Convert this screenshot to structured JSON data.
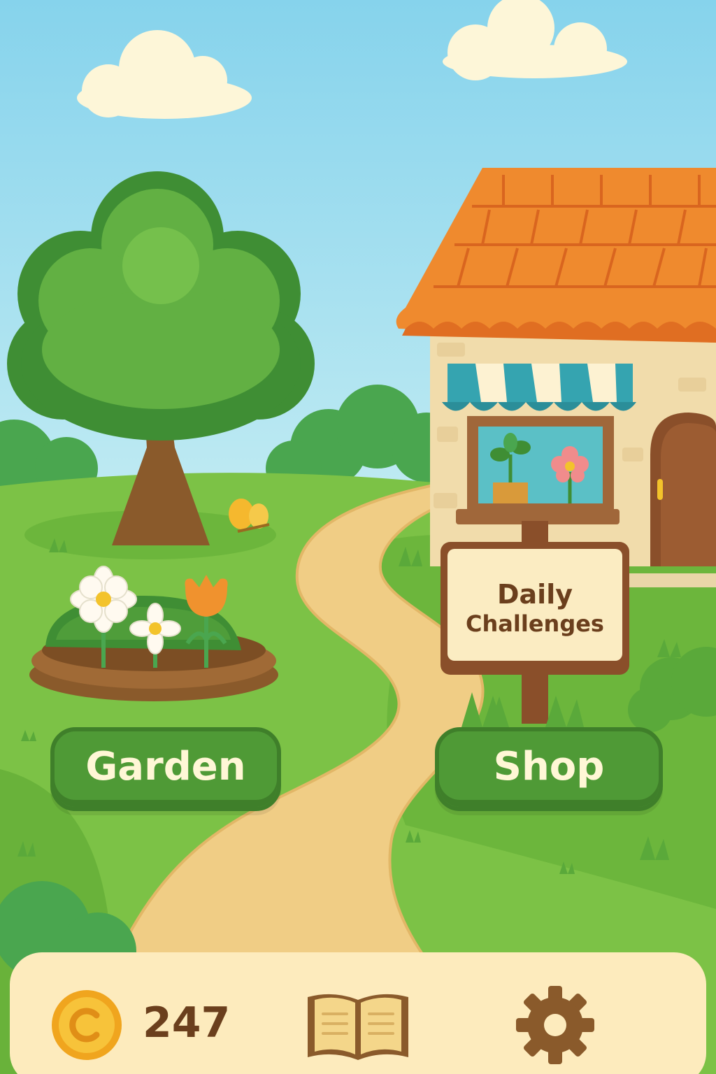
{
  "sign": {
    "line1": "Daily",
    "line2": "Challenges"
  },
  "buttons": {
    "garden": "Garden",
    "shop": "Shop"
  },
  "bottom_bar": {
    "coin_count": "247",
    "coin_icon": "coin-icon",
    "book_icon": "journal-book-icon",
    "settings_icon": "gear-icon"
  },
  "colors": {
    "sky": "#8fd7ee",
    "grass": "#7cc246",
    "button_green": "#4f9a36",
    "button_text": "#fff7d6",
    "roof": "#ef8a2e",
    "text_brown": "#6b3f1d",
    "bar_bg": "#fdebbd"
  }
}
